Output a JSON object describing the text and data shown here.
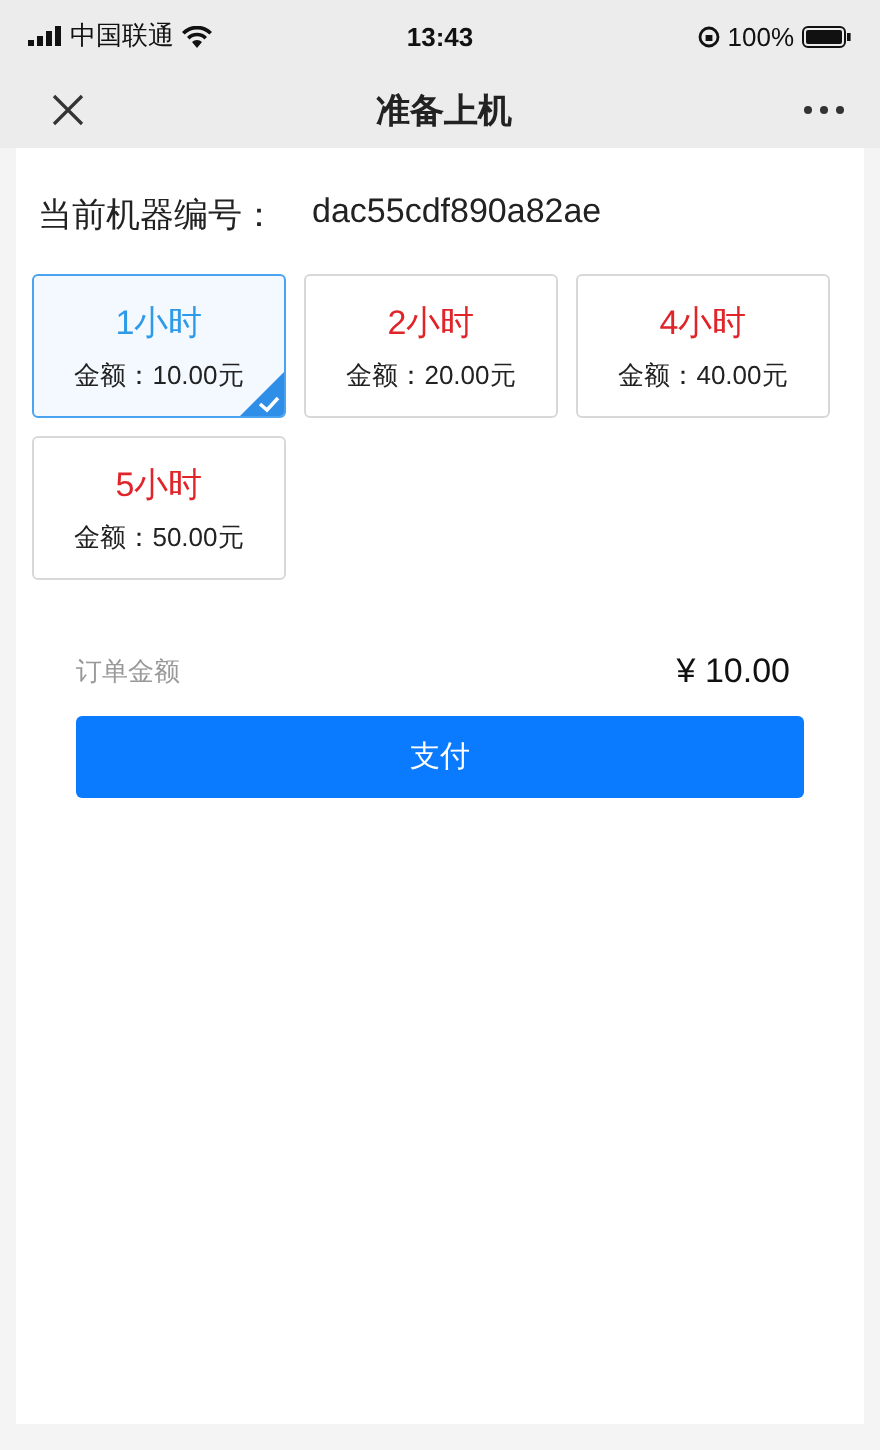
{
  "status_bar": {
    "carrier": "中国联通",
    "time": "13:43",
    "battery": "100%"
  },
  "nav": {
    "title": "准备上机"
  },
  "machine": {
    "label": "当前机器编号：",
    "value": "dac55cdf890a82ae"
  },
  "plans": [
    {
      "duration": "1小时",
      "price": "金额：10.00元",
      "selected": true
    },
    {
      "duration": "2小时",
      "price": "金额：20.00元",
      "selected": false
    },
    {
      "duration": "4小时",
      "price": "金额：40.00元",
      "selected": false
    },
    {
      "duration": "5小时",
      "price": "金额：50.00元",
      "selected": false
    }
  ],
  "order": {
    "label": "订单金额",
    "amount": "¥ 10.00"
  },
  "pay_button": "支付"
}
